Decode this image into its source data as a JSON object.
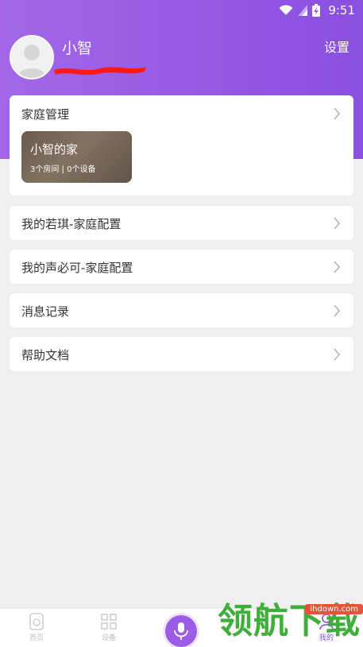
{
  "status_bar": {
    "time": "9:51"
  },
  "profile": {
    "username": "小智",
    "settings_label": "设置"
  },
  "family_card": {
    "title": "家庭管理",
    "home": {
      "name": "小智的家",
      "meta": "3个房间 | 0个设备"
    }
  },
  "menu": [
    {
      "label": "我的若琪-家庭配置"
    },
    {
      "label": "我的声必可-家庭配置"
    },
    {
      "label": "消息记录"
    },
    {
      "label": "帮助文档"
    }
  ],
  "bottom_nav": {
    "items": [
      {
        "label": "首页",
        "icon": "speaker-icon"
      },
      {
        "label": "设备",
        "icon": "grid-icon"
      },
      {
        "label": "",
        "icon": "microphone-icon"
      },
      {
        "label": "我的",
        "icon": "user-icon"
      }
    ]
  },
  "watermark": {
    "text": "领航下载",
    "site": "ihdown.com"
  },
  "colors": {
    "accent": "#8a4fe0",
    "header_start": "#a367e8",
    "background": "#efefef"
  }
}
